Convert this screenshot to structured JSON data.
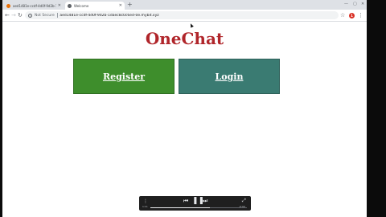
{
  "browser": {
    "tabs": [
      {
        "title": "aed1481e-ccdf-4d0f-9d2b-1daeec…",
        "active": false,
        "favicon_color": "#e8710a"
      },
      {
        "title": "Welcome",
        "active": true,
        "favicon_color": "#5f6368"
      }
    ],
    "newtab_symbol": "+",
    "address_bar": {
      "security_label": "Not Secure",
      "url": "aed1481e-ccdf-4d0f-9d2b-1daec8c0c6ed-0e.mybit.xyz"
    },
    "extension_label": "1"
  },
  "page": {
    "title": "OneChat",
    "register_label": "Register",
    "login_label": "Login"
  },
  "player": {
    "progress": 0.62,
    "elapsed": "1:11",
    "remaining": "-0:00"
  },
  "colors": {
    "title": "#b0252a",
    "register_bg": "#3e8e2c",
    "login_bg": "#3a7b72"
  }
}
